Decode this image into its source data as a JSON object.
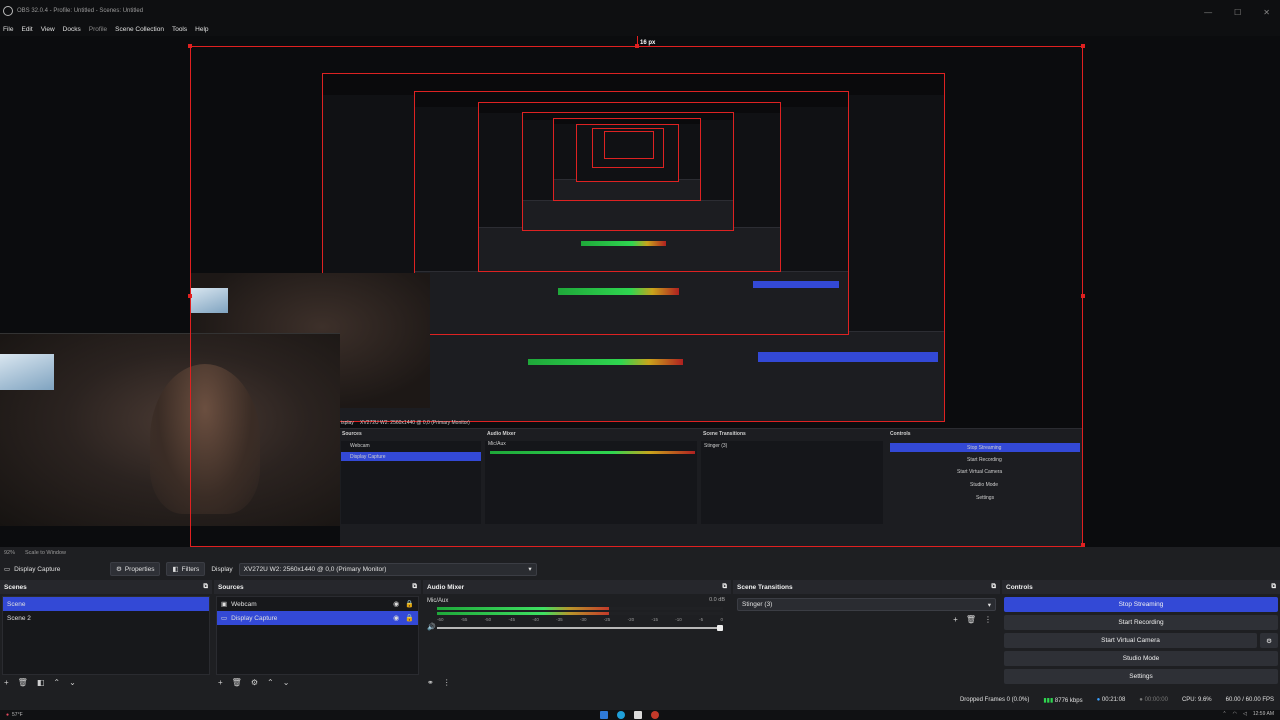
{
  "window": {
    "title": "OBS 32.0.4 - Profile: Untitled - Scenes: Untitled",
    "controls": [
      "—",
      "☐",
      "✕"
    ]
  },
  "menu": [
    "File",
    "Edit",
    "View",
    "Docks",
    "Profile",
    "Scene Collection",
    "Tools",
    "Help"
  ],
  "preview": {
    "px_label": "16 px"
  },
  "inner": {
    "sources_title": "Sources",
    "mixer_title": "Audio Mixer",
    "transitions_title": "Scene Transitions",
    "controls_title": "Controls",
    "display_name": "isplay",
    "display_value": "XV272U W2: 2560x1440 @ 0,0 (Primary Monitor)",
    "src1": "Webcam",
    "src2": "Display Capture",
    "mic": "Mic/Aux",
    "transition": "Stinger (3)",
    "btn1": "Stop Streaming",
    "btn2": "Start Recording",
    "btn3": "Start Virtual Camera",
    "btn4": "Studio Mode",
    "btn5": "Settings"
  },
  "status_line": {
    "zoom": "92%",
    "scale": "Scale to Window"
  },
  "propbar": {
    "source_name": "Display Capture",
    "properties": "Properties",
    "filters": "Filters",
    "display_label": "Display",
    "display_value": "XV272U W2: 2560x1440 @ 0,0 (Primary Monitor)"
  },
  "scenes": {
    "title": "Scenes",
    "items": [
      "Scene",
      "Scene 2"
    ]
  },
  "sources": {
    "title": "Sources",
    "items": [
      "Webcam",
      "Display Capture"
    ]
  },
  "mixer": {
    "title": "Audio Mixer",
    "channel": "Mic/Aux",
    "db": "0.0 dB",
    "ticks": [
      "-60",
      "-55",
      "-50",
      "-45",
      "-40",
      "-35",
      "-30",
      "-25",
      "-20",
      "-15",
      "-10",
      "-5",
      "0"
    ],
    "level": 0.6
  },
  "transitions": {
    "title": "Scene Transitions",
    "selected": "Stinger (3)"
  },
  "controls": {
    "title": "Controls",
    "stop_streaming": "Stop Streaming",
    "start_recording": "Start Recording",
    "start_virtual_camera": "Start Virtual Camera",
    "studio_mode": "Studio Mode",
    "settings": "Settings"
  },
  "status": {
    "dropped": "Dropped Frames 0 (0.0%)",
    "bitrate": "8776 kbps",
    "stream_time": "00:21:08",
    "rec_time": "00:00:00",
    "cpu": "CPU: 9.6%",
    "fps": "60.00 / 60.00 FPS"
  },
  "taskbar": {
    "weather": "57°F",
    "time": "12:59 AM"
  },
  "colors": {
    "accent": "#3349d6",
    "outline": "#e02020",
    "bg": "#1e1f22"
  }
}
